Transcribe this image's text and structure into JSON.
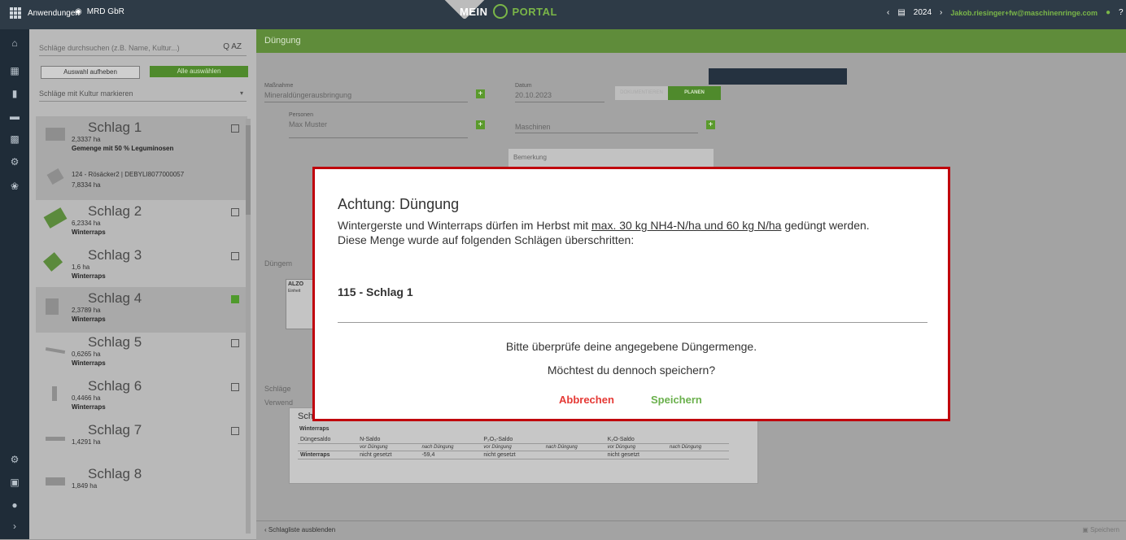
{
  "topbar": {
    "apps_label": "Anwendungen",
    "org_label": "MRD GbR",
    "logo_left": "MEIN",
    "logo_right": "PORTAL",
    "year": "2024",
    "email": "Jakob.riesinger+fw@maschinenringe.com",
    "prev_glyph": "‹",
    "next_glyph": "›",
    "help_glyph": "?"
  },
  "panel": {
    "search_placeholder": "Schläge durchsuchen (z.B. Name, Kultur...)",
    "sort_label": "Q AZ",
    "deselect_label": "Auswahl aufheben",
    "select_all_label": "Alle auswählen",
    "mark_label": "Schläge mit Kultur markieren",
    "fields": [
      {
        "name": "Schlag 1",
        "ha": "2,3337 ha",
        "crop": "Gemenge mit 50 % Leguminosen",
        "checked": false,
        "selected": true
      },
      {
        "name": "Schlag 2",
        "ha": "6,2334 ha",
        "crop": "Winterraps",
        "checked": false,
        "selected": false
      },
      {
        "name": "Schlag 3",
        "ha": "1,6 ha",
        "crop": "Winterraps",
        "checked": false,
        "selected": false
      },
      {
        "name": "Schlag 4",
        "ha": "2,3789 ha",
        "crop": "Winterraps",
        "checked": true,
        "selected": true
      },
      {
        "name": "Schlag 5",
        "ha": "0,6265 ha",
        "crop": "Winterraps",
        "checked": false,
        "selected": false
      },
      {
        "name": "Schlag 6",
        "ha": "0,4466 ha",
        "crop": "Winterraps",
        "checked": false,
        "selected": false
      },
      {
        "name": "Schlag 7",
        "ha": "1,4291 ha",
        "crop": "",
        "checked": false,
        "selected": false
      },
      {
        "name": "Schlag 8",
        "ha": "1,849 ha",
        "crop": "",
        "checked": false,
        "selected": false
      }
    ],
    "sub_field": {
      "line1": "124 - Rösäcker2 | DEBYLI8077000057",
      "line2": "7,8334 ha"
    }
  },
  "main": {
    "title": "Düngung",
    "massnahme_label": "Maßnahme",
    "massnahme_value": "Mineraldüngerausbringung",
    "datum_label": "Datum",
    "datum_value": "20.10.2023",
    "seg_a": "DOKUMENTIEREN",
    "seg_b": "PLANEN",
    "personen_label": "Personen",
    "personen_value": "Max Muster",
    "maschinen_label": "Maschinen",
    "bemerkung_label": "Bemerkung",
    "duenge_label": "Düngem",
    "mini_title": "ALZO",
    "mini_sub": "Einheit",
    "schlaege_label": "Schläge",
    "verwende_label": "Verwend",
    "card_title": "Schlag 1 - 2,56 ha",
    "card_crop": "Winterraps",
    "table_headers": [
      "Düngesaldo",
      "N-Saldo",
      "",
      "P₂O₅-Saldo",
      "",
      "K₂O-Saldo",
      ""
    ],
    "table_sub": [
      "",
      "vor Düngung",
      "nach Düngung",
      "vor Düngung",
      "nach Düngung",
      "vor Düngung",
      "nach Düngung"
    ],
    "table_row": [
      "Winterraps",
      "nicht gesetzt",
      "-59,4",
      "nicht gesetzt",
      "",
      "nicht gesetzt",
      ""
    ],
    "hide_list": "Schlagliste ausblenden",
    "save_footer": "Speichern"
  },
  "modal": {
    "title": "Achtung: Düngung",
    "line1_pre": "Wintergerste und Winterraps dürfen im Herbst mit ",
    "line1_link": "max. 30 kg NH4-N/ha und 60 kg N/ha",
    "line1_post": " gedüngt werden.",
    "line2": "Diese Menge wurde auf folgenden Schlägen überschritten:",
    "field_ref": "115 - Schlag 1",
    "question1": "Bitte überprüfe deine angegebene Düngermenge.",
    "question2": "Möchtest du dennoch speichern?",
    "cancel": "Abbrechen",
    "save": "Speichern"
  },
  "colors": {
    "accent": "#6ab04c",
    "danger": "#e53935",
    "modal_border": "#c0000c"
  }
}
